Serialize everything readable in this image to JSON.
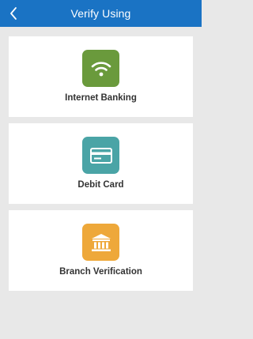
{
  "header": {
    "title": "Verify Using",
    "back_icon": "chevron-left-icon",
    "background": "#1a73c4"
  },
  "options": [
    {
      "label": "Internet Banking",
      "icon": "wifi-icon",
      "color": "#6a9a3c"
    },
    {
      "label": "Debit Card",
      "icon": "credit-card-icon",
      "color": "#4aa4a6"
    },
    {
      "label": "Branch Verification",
      "icon": "bank-icon",
      "color": "#eea83a"
    }
  ]
}
